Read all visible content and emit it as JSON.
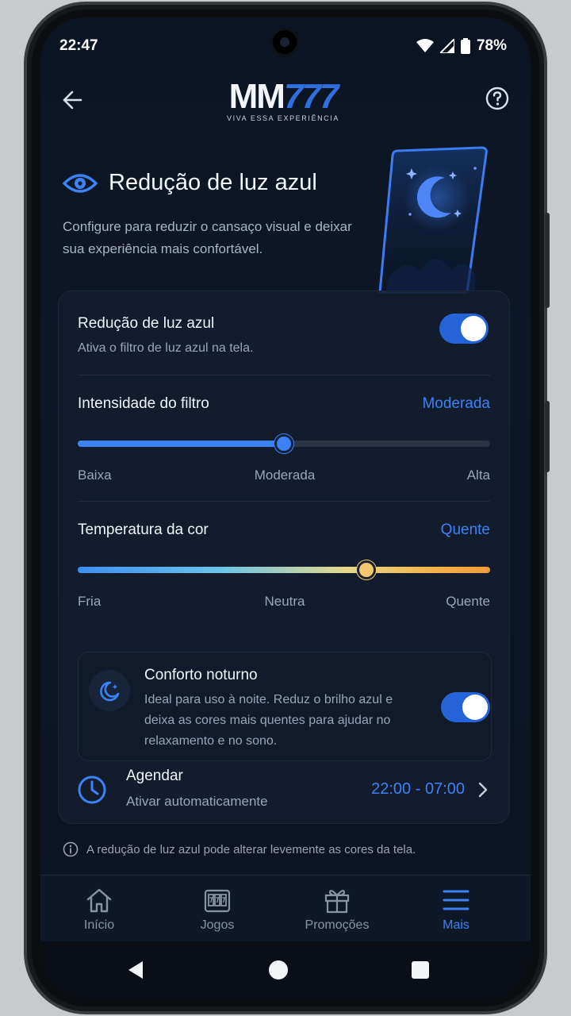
{
  "status": {
    "time": "22:47",
    "battery": "78%"
  },
  "header": {
    "logo_main": "MM",
    "logo_accent": "777",
    "logo_tagline": "VIVA ESSA EXPERIÊNCIA"
  },
  "hero": {
    "title": "Redução de luz azul",
    "description": "Configure para reduzir o cansaço visual e deixar sua experiência mais confortável."
  },
  "settings": {
    "blue_light": {
      "title": "Redução de luz azul",
      "subtitle": "Ativa o filtro de luz azul na tela.",
      "enabled": true
    },
    "intensity": {
      "title": "Intensidade do filtro",
      "value": "Moderada",
      "level": 0.5,
      "scale": [
        "Baixa",
        "Moderada",
        "Alta"
      ]
    },
    "temperature": {
      "title": "Temperatura da cor",
      "value": "Quente",
      "level": 0.7,
      "scale": [
        "Fria",
        "Neutra",
        "Quente"
      ]
    },
    "night_comfort": {
      "title": "Conforto noturno",
      "description": "Ideal para uso à noite. Reduz o brilho azul e deixa as cores mais quentes para ajudar no relaxamento e no sono.",
      "enabled": true
    },
    "schedule": {
      "title": "Agendar",
      "subtitle": "Ativar automaticamente",
      "value": "22:00 - 07:00"
    }
  },
  "info_note": "A redução de luz azul pode alterar levemente as cores da tela.",
  "bottom_nav": {
    "items": [
      {
        "label": "Início",
        "icon": "home-icon"
      },
      {
        "label": "Jogos",
        "icon": "slot-machine-icon"
      },
      {
        "label": "Promoções",
        "icon": "gift-icon"
      },
      {
        "label": "Mais",
        "icon": "menu-icon",
        "active": true
      }
    ]
  },
  "colors": {
    "accent": "#3b82f6",
    "background": "#0b1422",
    "card": "#141e2d",
    "warm": "#f6c970"
  }
}
